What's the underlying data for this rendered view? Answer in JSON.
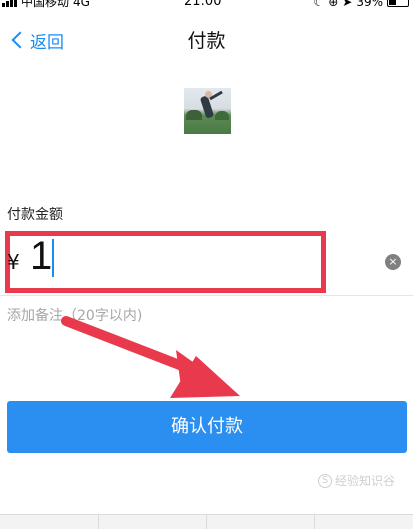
{
  "status_bar": {
    "carrier": "中国移动",
    "network": "4G",
    "time": "21:00",
    "battery": "39%",
    "icons": [
      "moon-icon",
      "lock-rotation-icon",
      "location-icon",
      "battery-icon"
    ]
  },
  "nav": {
    "back_label": "返回",
    "title": "付款"
  },
  "payment": {
    "amount_label": "付款金额",
    "currency_symbol": "¥",
    "amount_value": "1",
    "clear_icon": "×",
    "note_placeholder": "添加备注（20字以内)"
  },
  "actions": {
    "confirm_label": "确认付款"
  },
  "watermark": {
    "text": "经验知识谷",
    "logo_letter": "S"
  },
  "colors": {
    "accent": "#2a8ff0",
    "link": "#1a8cf0",
    "highlight_box": "#e8394d"
  }
}
